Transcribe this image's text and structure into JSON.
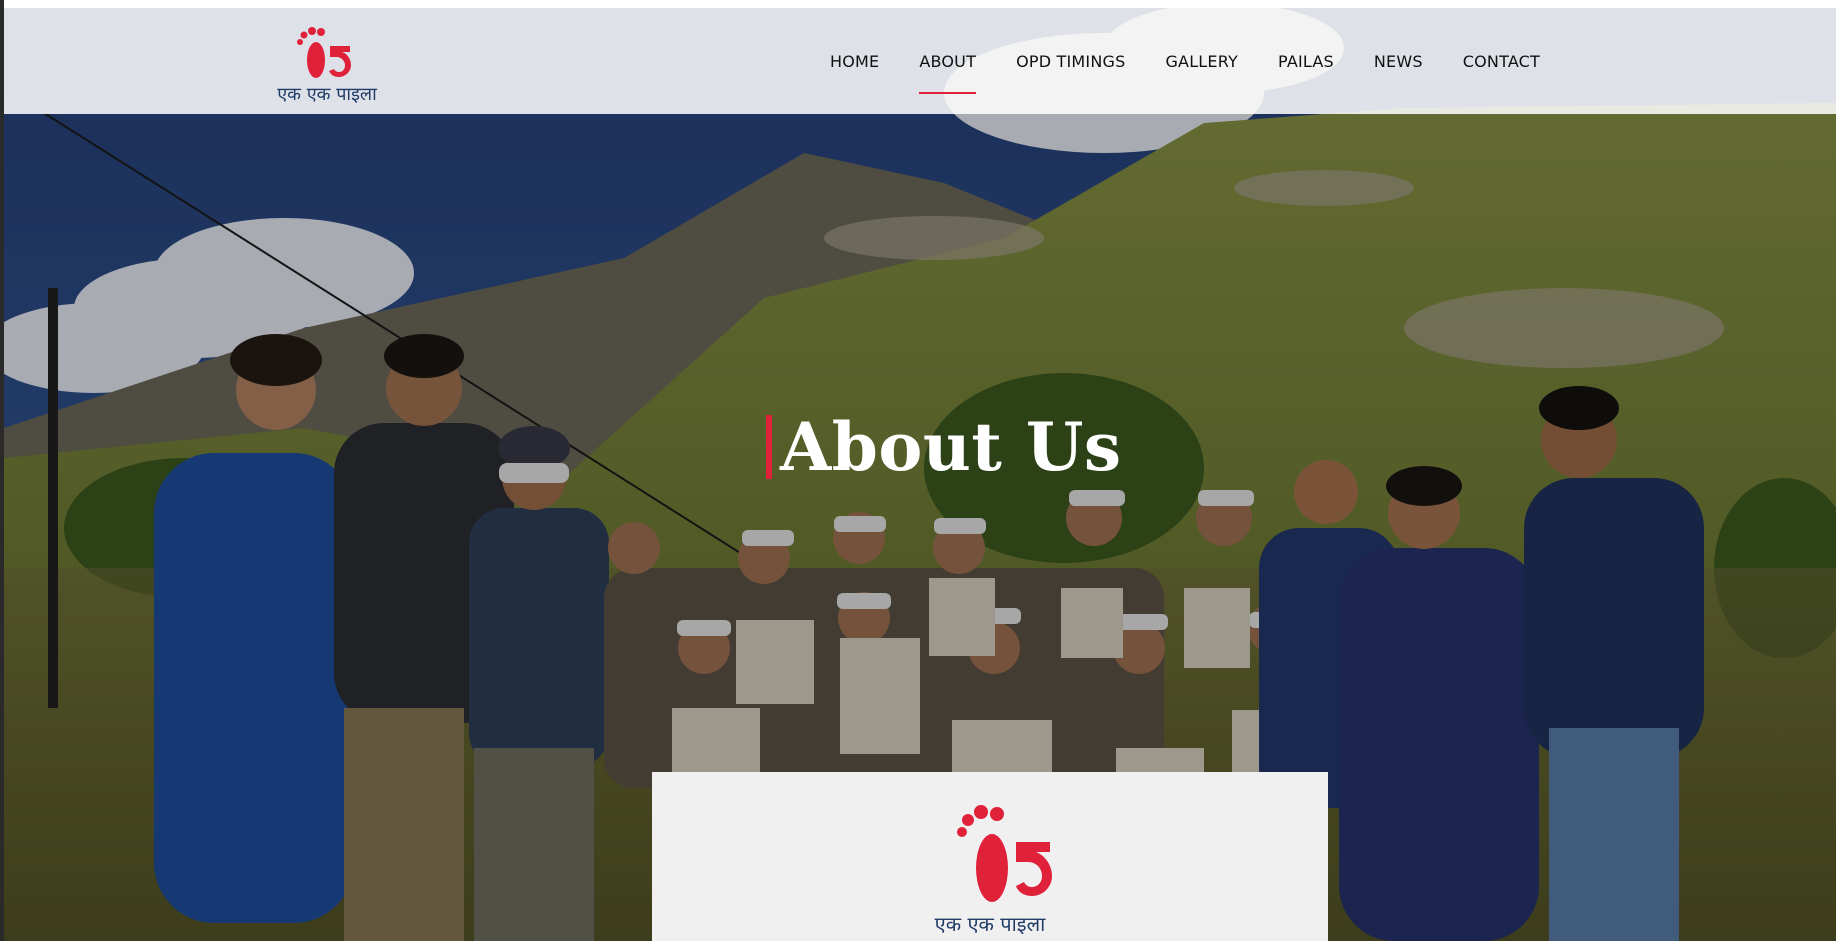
{
  "brand": {
    "logo_text": "एक एक पाइला",
    "logo_mark": "footprint-logo",
    "accent": "#e0213a",
    "text_blue": "#1f3b66"
  },
  "nav": {
    "items": [
      {
        "label": "HOME"
      },
      {
        "label": "ABOUT"
      },
      {
        "label": "OPD TIMINGS"
      },
      {
        "label": "GALLERY"
      },
      {
        "label": "PAILAS"
      },
      {
        "label": "NEWS"
      },
      {
        "label": "CONTACT"
      }
    ],
    "active": "ABOUT"
  },
  "hero": {
    "title": "About Us",
    "banner_text": "एक एक पाइला"
  }
}
